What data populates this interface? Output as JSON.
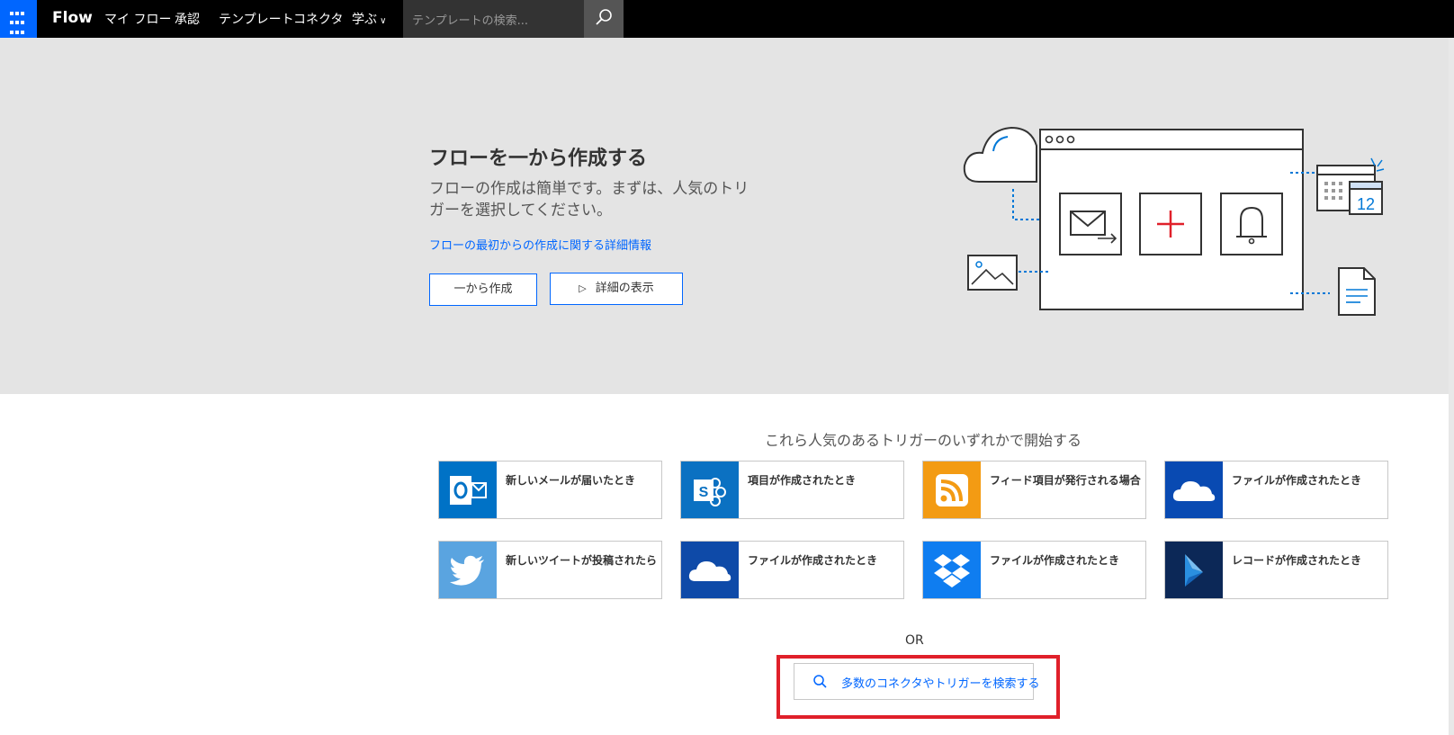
{
  "topbar": {
    "brand": "Flow",
    "nav": [
      "マイ フロー",
      "承認",
      "テンプレート",
      "コネクタ",
      "学ぶ"
    ],
    "search_placeholder": "テンプレートの検索..."
  },
  "hero": {
    "title": "フローを一から作成する",
    "description": "フローの作成は簡単です。まずは、人気のトリガーを選択してください。",
    "link": "フローの最初からの作成に関する詳細情報",
    "create_button": "一から作成",
    "details_button": "詳細の表示",
    "calendar_day": "12"
  },
  "triggers": {
    "title": "これら人気のあるトリガーのいずれかで開始する",
    "cards": [
      {
        "label": "新しいメールが届いたとき",
        "icon": "outlook-icon",
        "color": "#0072c6"
      },
      {
        "label": "項目が作成されたとき",
        "icon": "sharepoint-icon",
        "color": "#0b71c2"
      },
      {
        "label": "フィード項目が発行される場合",
        "icon": "rss-icon",
        "color": "#f39b13"
      },
      {
        "label": "ファイルが作成されたとき",
        "icon": "onedrive-icon",
        "color": "#094ab2"
      },
      {
        "label": "新しいツイートが投稿されたら",
        "icon": "twitter-icon",
        "color": "#5aa4e0"
      },
      {
        "label": "ファイルが作成されたとき",
        "icon": "onedrive-icon",
        "color": "#0e4aa8"
      },
      {
        "label": "ファイルが作成されたとき",
        "icon": "dropbox-icon",
        "color": "#0f7df0"
      },
      {
        "label": "レコードが作成されたとき",
        "icon": "dynamics-icon",
        "color": "#0c2857"
      }
    ]
  },
  "or_text": "OR",
  "search_connectors": "多数のコネクタやトリガーを検索する",
  "colors": {
    "accent": "#0066ff",
    "highlight": "#e0202a",
    "hero_bg": "#e4e4e4"
  }
}
